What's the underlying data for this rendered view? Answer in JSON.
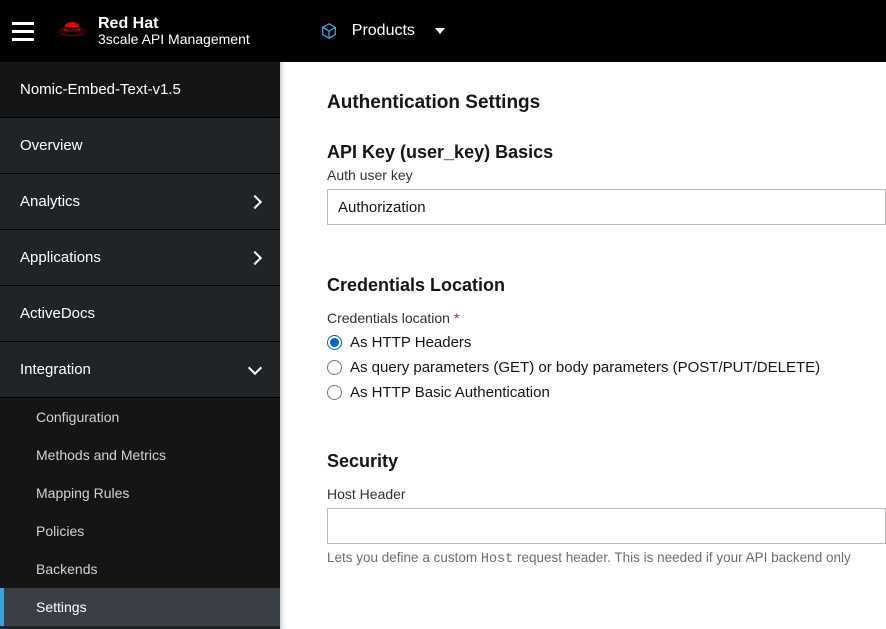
{
  "header": {
    "brand_top": "Red Hat",
    "brand_bottom": "3scale API Management",
    "context_label": "Products"
  },
  "sidebar": {
    "product_title": "Nomic-Embed-Text-v1.5",
    "items": {
      "overview": "Overview",
      "analytics": "Analytics",
      "applications": "Applications",
      "activedocs": "ActiveDocs",
      "integration": "Integration"
    },
    "integration_children": {
      "configuration": "Configuration",
      "methods": "Methods and Metrics",
      "mapping": "Mapping Rules",
      "policies": "Policies",
      "backends": "Backends",
      "settings": "Settings"
    }
  },
  "main": {
    "page_heading": "Authentication Settings",
    "api_key": {
      "title": "API Key (user_key) Basics",
      "auth_user_key_label": "Auth user key",
      "auth_user_key_value": "Authorization"
    },
    "credentials": {
      "title": "Credentials Location",
      "field_label": "Credentials location",
      "options": {
        "http_headers": "As HTTP Headers",
        "query_body": "As query parameters (GET) or body parameters (POST/PUT/DELETE)",
        "basic_auth": "As HTTP Basic Authentication"
      },
      "selected": "http_headers"
    },
    "security": {
      "title": "Security",
      "host_header_label": "Host Header",
      "host_header_value": "",
      "host_help_prefix": "Lets you define a custom ",
      "host_help_code": "Host",
      "host_help_suffix": " request header. This is needed if your API backend only"
    }
  }
}
